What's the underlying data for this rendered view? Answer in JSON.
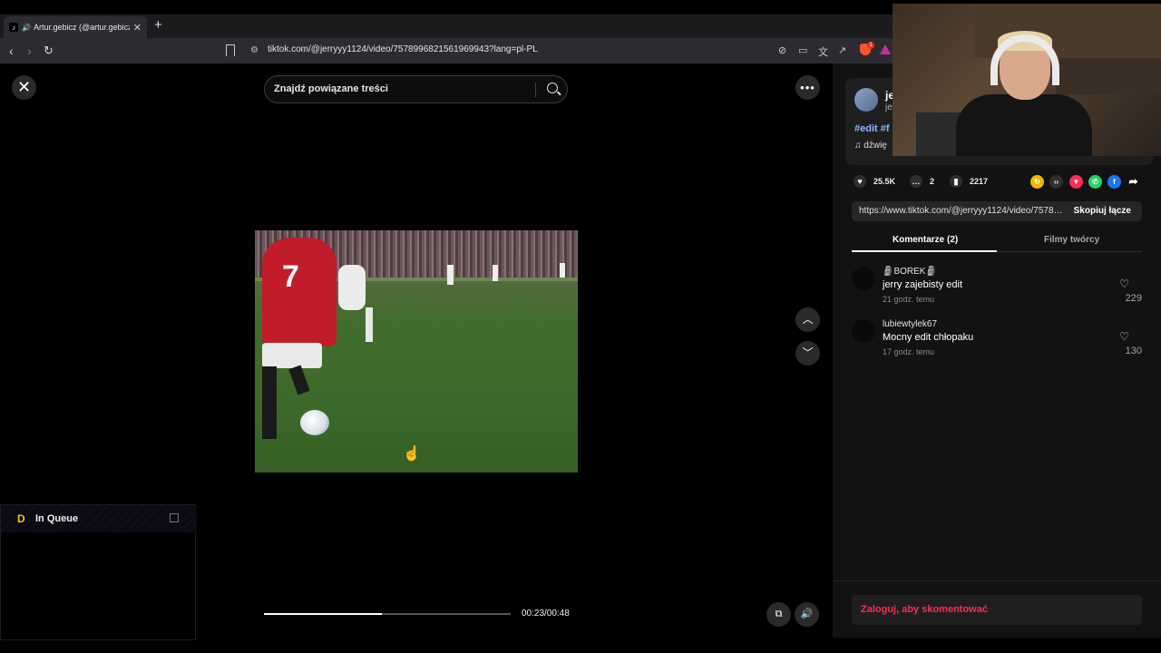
{
  "browser": {
    "tab_title": "Artur.gebicz (@artur.gebicz) |",
    "url": "tiktok.com/@jerryyy1124/video/7578996821561969943?lang=pl-PL"
  },
  "search": {
    "placeholder": "Znajdź powiązane treści"
  },
  "player": {
    "time": "00:23/00:48",
    "progress": 0.479
  },
  "video_overlay": {
    "jersey_number": "7"
  },
  "queue": {
    "title": "In Queue"
  },
  "author": {
    "name": "je",
    "sub": "je",
    "hashtags": "#edit #f",
    "sound": "dźwię"
  },
  "stats": {
    "likes": "25.5K",
    "comments": "2",
    "saves": "2217"
  },
  "share": {
    "link": "https://www.tiktok.com/@jerryyy1124/video/75789...",
    "copy_label": "Skopiuj łącze"
  },
  "tabs": [
    {
      "label": "Komentarze (2)",
      "active": true
    },
    {
      "label": "Filmy twórcy",
      "active": false
    }
  ],
  "comments": [
    {
      "user": "🗿BOREK🗿",
      "text": "jerry zajebisty edit",
      "time": "21 godz. temu",
      "likes": "229"
    },
    {
      "user": "lubiewtylek67",
      "text": "Mocny edit chłopaku",
      "time": "17 godz. temu",
      "likes": "130"
    }
  ],
  "login_prompt": "Zaloguj, aby skomentować",
  "colors": {
    "accent": "#fe2c55",
    "hashtag": "#8fb7ff",
    "queue_logo": "#f3c325"
  }
}
